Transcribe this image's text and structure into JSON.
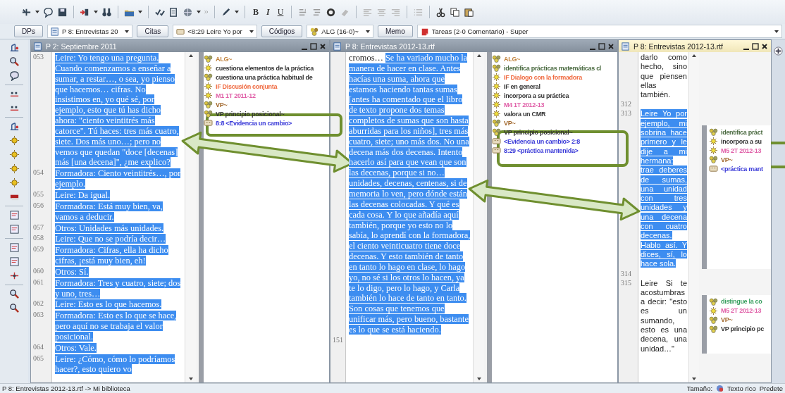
{
  "toolbar": {
    "format_buttons": [
      "B",
      "I",
      "U"
    ]
  },
  "selectors": [
    {
      "kind": "button",
      "label": "DPs"
    },
    {
      "kind": "document",
      "value": "P 8: Entrevistas 20"
    },
    {
      "kind": "button",
      "label": "Citas"
    },
    {
      "kind": "quotation",
      "value": "<8:29 Leire Yo por"
    },
    {
      "kind": "button",
      "label": "Códigos"
    },
    {
      "kind": "code",
      "value": "ALG (16-0)~"
    },
    {
      "kind": "button",
      "label": "Memo"
    },
    {
      "kind": "memo",
      "value": "Tareas (2-0 Comentario) - Super"
    }
  ],
  "panes": [
    {
      "title": "P 2: Septiembre 2011",
      "active": false,
      "paragraphs": [
        {
          "number": "053",
          "segments": [
            {
              "text": "Leire: Yo tengo una pregunta. Cuando comenzamos a enseñar a sumar, a restar…, o sea, yo pienso que hacemos… cifras. No insistimos en, yo qué sé, por ejemplo, esto que tú has dicho ahora: \"ciento veintitrés más catorce\". Tú haces: tres más cuatro, siete. Dos más uno…; pero no vemos que quedan \"doce [decenas] más [una decena]\", ¿me explico?",
              "selected": true
            }
          ],
          "codes": [
            {
              "kind": "group",
              "text": "ALG~",
              "color": "#c0803a"
            },
            {
              "kind": "code",
              "text": "cuestiona elementos de la práctica",
              "color": "#333333"
            },
            {
              "kind": "group",
              "text": "cuestiona una práctica habitual de",
              "color": "#333333"
            },
            {
              "kind": "code",
              "text": "IF Discusión conjunta",
              "color": "#f06a40"
            },
            {
              "kind": "code",
              "text": "M1 1T 2011-12",
              "color": "#e060a8"
            },
            {
              "kind": "group",
              "text": "VP~",
              "color": "#a0662a"
            },
            {
              "kind": "group",
              "text": "VP principio posicional~",
              "color": "#333333"
            },
            {
              "kind": "quotation",
              "text": "8:8 <Evidencia un cambio>",
              "color": "#3a3ad8"
            }
          ]
        },
        {
          "number": "054",
          "segments": [
            {
              "text": "Formadora: Ciento veintitrés…, por ejemplo.",
              "selected": true
            }
          ]
        },
        {
          "number": "055",
          "segments": [
            {
              "text": "Leire: Da igual.",
              "selected": true
            }
          ]
        },
        {
          "number": "056",
          "segments": [
            {
              "text": "Formadora: Está muy bien, va, vamos a deducir.",
              "selected": true
            }
          ]
        },
        {
          "number": "057",
          "segments": [
            {
              "text": "Otros: Unidades más unidades.",
              "selected": true
            }
          ]
        },
        {
          "number": "058",
          "segments": [
            {
              "text": "Leire: Que no se podría decir…",
              "selected": true
            }
          ]
        },
        {
          "number": "059",
          "segments": [
            {
              "text": "Formadora: Cifras, ella ha dicho cifras, ¡está muy bien, eh!",
              "selected": true
            }
          ]
        },
        {
          "number": "060",
          "segments": [
            {
              "text": "Otros: Sí.",
              "selected": true
            }
          ]
        },
        {
          "number": "061",
          "segments": [
            {
              "text": "Formadora: Tres y cuatro, siete; dos y uno, tres…",
              "selected": true
            }
          ]
        },
        {
          "number": "062",
          "segments": [
            {
              "text": "Leire: Esto es lo que hacemos.",
              "selected": true
            }
          ]
        },
        {
          "number": "063",
          "segments": [
            {
              "text": "Formadora: Esto es lo que se hace, pero aquí no se trabaja el valor posicional.",
              "selected": true
            }
          ]
        },
        {
          "number": "064",
          "segments": [
            {
              "text": "Otros: Vale.",
              "selected": true
            }
          ]
        },
        {
          "number": "065",
          "segments": [
            {
              "text": "Leire: ¿Cómo, cómo lo podríamos hacer?, esto quiero vo",
              "selected": true
            }
          ]
        }
      ]
    },
    {
      "title": "P 8: Entrevistas 2012-13.rtf",
      "active": false,
      "paragraphs": [
        {
          "segments": [
            {
              "text": "cromos… ",
              "selected": false
            },
            {
              "text": "Se ha variado mucho la manera de hacer en clase. Antes hacías una suma, ahora que estamos haciendo tantas sumas [antes ha comentado que el libro de texto propone dos temas completos de sumas que son hasta aburridas para los niños], tres más cuatro, siete; uno más dos. No una decena más dos decenas. Intento hacerlo así para que vean que son las decenas, porque si no… unidades, decenas, centenas, si de memoria lo ven, pero dónde están las decenas colocadas. Y qué es cada cosa. Y lo que añadía aquí también, porque yo esto no lo sabía, lo aprendí con la formadora, el ciento veinticuatro tiene doce decenas. Y esto también de tanto en tanto lo hago en clase, lo hago yo, no sé si los otros lo hacen, ya te lo digo, pero lo hago, y Carla también lo hace de tanto en tanto. Son cosas que tenemos que unificar más, pero bueno, bastante es lo que se está haciendo.",
              "selected": true
            }
          ],
          "codes": [
            {
              "kind": "group",
              "text": "ALG~",
              "color": "#c0803a"
            },
            {
              "kind": "group",
              "text": "identifica prácticas matemáticas cl",
              "color": "#4a6a40"
            },
            {
              "kind": "code",
              "text": "IF Dialogo con la formadora",
              "color": "#f06a40"
            },
            {
              "kind": "code",
              "text": "IF en general",
              "color": "#333333"
            },
            {
              "kind": "code",
              "text": "incorpora a su práctica",
              "color": "#333333"
            },
            {
              "kind": "code",
              "text": "M4 1T 2012-13",
              "color": "#e060a8"
            },
            {
              "kind": "code",
              "text": "valora un CMR",
              "color": "#333333"
            },
            {
              "kind": "group",
              "text": "VP~",
              "color": "#a0662a"
            },
            {
              "kind": "group",
              "text": "VP principio posicional~",
              "color": "#333333"
            },
            {
              "kind": "quotation",
              "text": "<Evidencia un cambio> 2:8",
              "color": "#3a3ad8"
            },
            {
              "kind": "quotation",
              "text": "8:29 <práctica mantenida>",
              "color": "#3a3ad8"
            }
          ]
        },
        {
          "number": "151"
        }
      ]
    },
    {
      "title": "P 8: Entrevistas 2012-13.rtf",
      "active": true,
      "paragraphs": [
        {
          "segments": [
            {
              "text": "darlo como hecho, sino que piensen ellas también.",
              "selected": false
            }
          ]
        },
        {
          "number": "312"
        },
        {
          "number": "313",
          "segments": [
            {
              "text": "Leire Yo por ejemplo, mi sobrina hace primero y le dije a mi hermana: trae deberes de sumas, una unidad con tres unidades y una decena con cuatro decenas. Hablo así. Y dices, sí, lo hace sola.",
              "selected": true
            }
          ],
          "codes": [
            {
              "kind": "group",
              "text": "identifica práct",
              "color": "#4a6a40"
            },
            {
              "kind": "code",
              "text": "incorpora a su",
              "color": "#333333"
            },
            {
              "kind": "code",
              "text": "M5 2T 2012-13",
              "color": "#e060a8"
            },
            {
              "kind": "group",
              "text": "VP~",
              "color": "#a0662a"
            },
            {
              "kind": "quotation",
              "text": "<práctica mant",
              "color": "#3a3ad8"
            }
          ]
        },
        {
          "number": "314"
        },
        {
          "number": "315",
          "segments": [
            {
              "text": "Leire Si te acostumbras a decir: \"esto es un sumando, esto es una decena, una unidad…\"",
              "selected": false
            }
          ],
          "codes": [
            {
              "kind": "group",
              "text": "distingue la co",
              "color": "#3aa060"
            },
            {
              "kind": "code",
              "text": "M5 2T 2012-13",
              "color": "#e060a8"
            },
            {
              "kind": "group",
              "text": "VP~",
              "color": "#a0662a"
            },
            {
              "kind": "group",
              "text": "VP principio pc",
              "color": "#333333"
            }
          ]
        }
      ]
    }
  ],
  "status_bar": {
    "location": "P 8: Entrevistas 2012-13.rtf ->  Mi biblioteca",
    "items": [
      "Tamaño:",
      "Texto rico",
      "Predete"
    ]
  }
}
